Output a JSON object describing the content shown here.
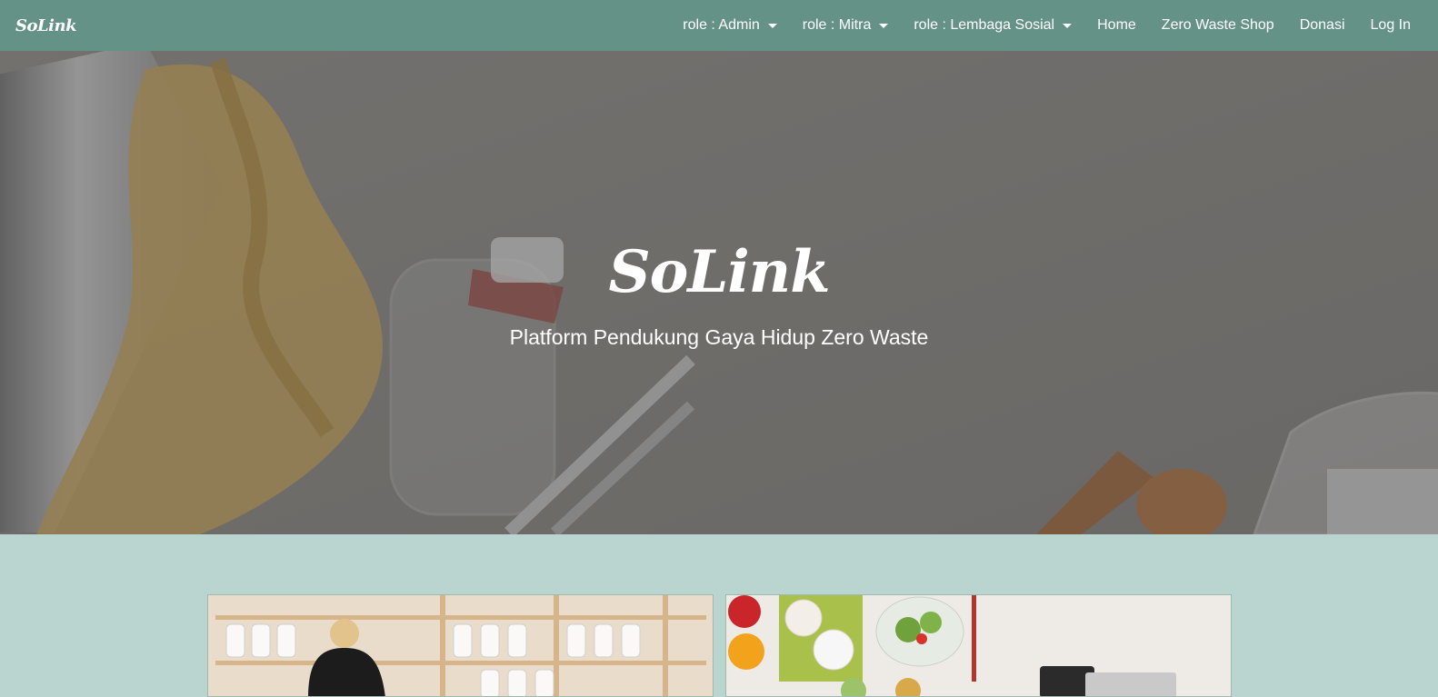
{
  "brand": "SoLink",
  "nav": {
    "items": [
      {
        "label": "role : Admin",
        "dropdown": true
      },
      {
        "label": "role : Mitra",
        "dropdown": true
      },
      {
        "label": "role : Lembaga Sosial",
        "dropdown": true
      },
      {
        "label": "Home",
        "dropdown": false
      },
      {
        "label": "Zero Waste Shop",
        "dropdown": false
      },
      {
        "label": "Donasi",
        "dropdown": false
      },
      {
        "label": "Log In",
        "dropdown": false
      }
    ]
  },
  "hero": {
    "title": "SoLink",
    "subtitle": "Platform Pendukung Gaya Hidup Zero Waste"
  },
  "colors": {
    "navbar": "#659286",
    "section_bg": "#bad5cf",
    "text": "#ffffff"
  }
}
